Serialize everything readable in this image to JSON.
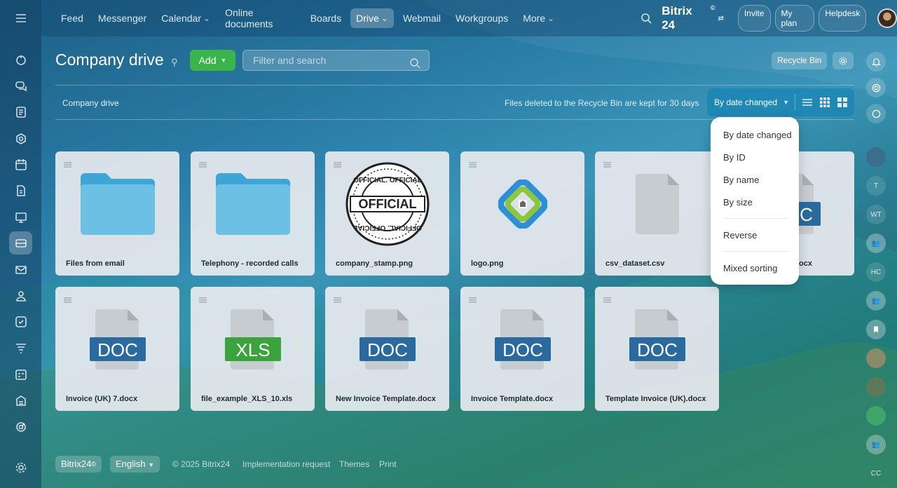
{
  "topbar": {
    "nav": [
      {
        "label": "Feed",
        "chevron": false,
        "active": false
      },
      {
        "label": "Messenger",
        "chevron": false,
        "active": false
      },
      {
        "label": "Calendar",
        "chevron": true,
        "active": false
      },
      {
        "label": "Online documents",
        "chevron": false,
        "active": false
      },
      {
        "label": "Boards",
        "chevron": false,
        "active": false
      },
      {
        "label": "Drive",
        "chevron": true,
        "active": true
      },
      {
        "label": "Webmail",
        "chevron": false,
        "active": false
      },
      {
        "label": "Workgroups",
        "chevron": false,
        "active": false
      },
      {
        "label": "More",
        "chevron": true,
        "active": false
      }
    ],
    "brand": "Bitrix 24",
    "brand_mark": "©",
    "invite": "Invite",
    "my_plan": "My plan",
    "helpdesk": "Helpdesk"
  },
  "header": {
    "title": "Company drive",
    "add_label": "Add",
    "search_placeholder": "Filter and search",
    "recycle_bin": "Recycle Bin"
  },
  "toolbar": {
    "breadcrumb": "Company drive",
    "notice": "Files deleted to the Recycle Bin are kept for 30 days",
    "sort_label": "By date changed"
  },
  "sort_menu": {
    "items": [
      "By date changed",
      "By ID",
      "By name",
      "By size",
      "Reverse",
      "Mixed sorting"
    ]
  },
  "files": [
    {
      "name": "Files from email",
      "kind": "folder"
    },
    {
      "name": "Telephony - recorded calls",
      "kind": "folder"
    },
    {
      "name": "company_stamp.png",
      "kind": "stamp"
    },
    {
      "name": "logo.png",
      "kind": "logo"
    },
    {
      "name": "csv_dataset.csv",
      "kind": "blank"
    },
    {
      "name": "ocx",
      "kind": "doc",
      "badge": "DOC"
    },
    {
      "name": "Invoice (UK) 7.docx",
      "kind": "doc",
      "badge": "DOC"
    },
    {
      "name": "file_example_XLS_10.xls",
      "kind": "xls",
      "badge": "XLS"
    },
    {
      "name": "New Invoice Template.docx",
      "kind": "doc",
      "badge": "DOC"
    },
    {
      "name": "Invoice Template.docx",
      "kind": "doc",
      "badge": "DOC"
    },
    {
      "name": "Template Invoice (UK).docx",
      "kind": "doc",
      "badge": "DOC"
    }
  ],
  "stamp_text": {
    "center": "OFFICIAL",
    "ring": "OFFICIAL. OFFICIAL"
  },
  "right_bar": {
    "initials": [
      "T",
      "WT",
      "HC",
      "CC"
    ]
  },
  "footer": {
    "brand": "Bitrix24",
    "brand_mark": "©",
    "language": "English",
    "copyright": "© 2025 Bitrix24",
    "links": [
      "Implementation request",
      "Themes",
      "Print"
    ]
  },
  "colors": {
    "add_green": "#3bb54a",
    "doc_blue": "#2a6a9e",
    "xls_green": "#3aa33c",
    "folder_blue": "#6cc0e3"
  }
}
